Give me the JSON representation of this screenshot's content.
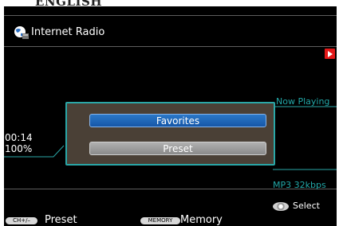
{
  "page_title": "ENGLISH",
  "header": {
    "title": "Internet Radio",
    "source_icon": "globe-icon"
  },
  "playback": {
    "status_icon": "play-icon",
    "now_playing_label": "Now Playing",
    "elapsed_time": "00:14",
    "buffer": "100%",
    "format": "MP3 32kbps"
  },
  "popup": {
    "options": [
      {
        "label": "Favorites",
        "selected": true
      },
      {
        "label": "Preset",
        "selected": false
      }
    ]
  },
  "footer": {
    "select_label": "Select",
    "ch_key_label": "CH+/–",
    "preset_label": "Preset",
    "memory_key_label": "MEMORY",
    "memory_label": "Memory"
  },
  "colors": {
    "accent_teal": "#2aa7a7",
    "highlight_blue": "#1f66b8",
    "dialog_bg": "#4a4036",
    "play_red": "#e31818"
  }
}
